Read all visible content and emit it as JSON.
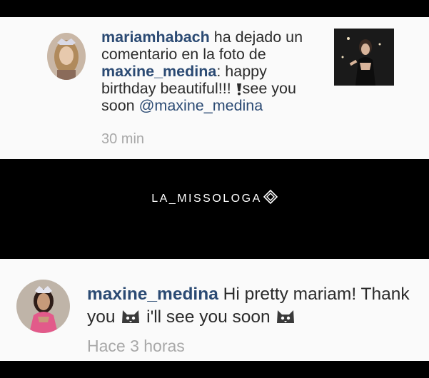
{
  "notification": {
    "username": "mariamhabach",
    "action_text": " ha dejado un comentario en la foto de ",
    "target_user": "maxine_medina",
    "comment_text": ": happy birthday beautiful!!! ",
    "comment_text_2": "see you soon ",
    "mention": "@maxine_medina",
    "timestamp": "30 min",
    "avatar_icon": "profile-photo-crowned-woman",
    "thumbnail_icon": "photo-thumbnail-woman-dark-dress"
  },
  "watermark": {
    "text": "LA_MISSOLOGA",
    "icon": "diamond-logo-icon"
  },
  "reply": {
    "username": "maxine_medina",
    "text": " Hi pretty mariam! Thank you ",
    "text_2": " i'll see you soon ",
    "timestamp": "Hace 3 horas",
    "avatar_icon": "profile-photo-crowned-woman-pink-gown",
    "emoji_1": "cat-face-icon",
    "emoji_2": "cat-face-icon"
  },
  "colors": {
    "username": "#2b4a73",
    "text": "#2b2b2b",
    "timestamp": "#a8a8a8",
    "panel": "#fafafa",
    "background": "#000000"
  }
}
